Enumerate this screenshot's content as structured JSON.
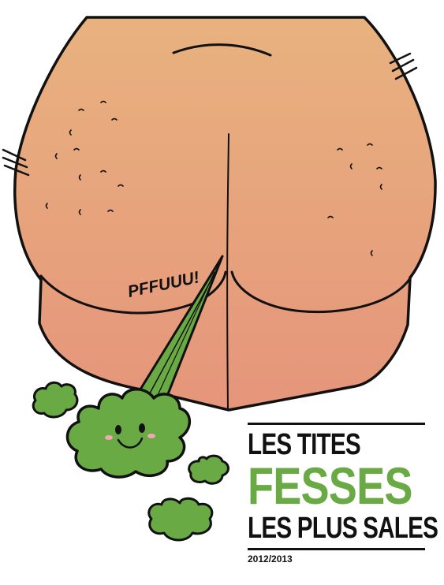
{
  "illustration": {
    "sound_effect": "PFFUUU!"
  },
  "title": {
    "line1": "LES TITES",
    "line2": "FESSES",
    "line3": "LES PLUS SALES",
    "year": "2012/2013"
  },
  "colors": {
    "skin_top": "#e8b27e",
    "skin_bottom": "#e6957b",
    "outline": "#111111",
    "gas_green": "#6aaa45",
    "title_green": "#6aaa45"
  }
}
